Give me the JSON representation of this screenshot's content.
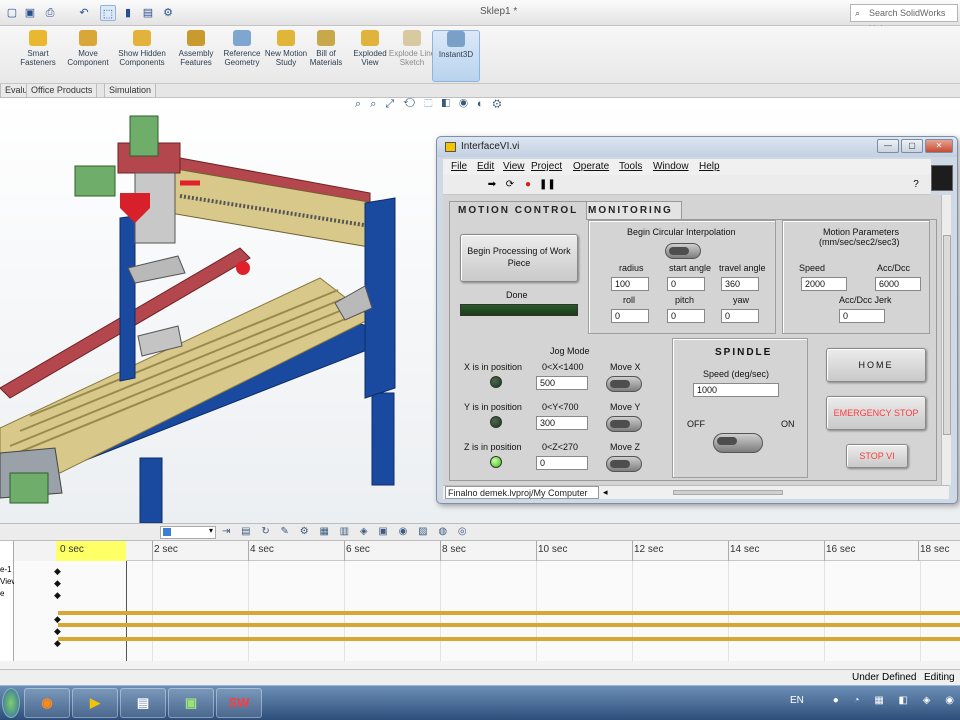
{
  "window": {
    "doc_title": "Sklep1 *",
    "search_placeholder": "Search SolidWorks Help"
  },
  "ribbon": {
    "buttons": [
      {
        "label": "Smart Fasteners"
      },
      {
        "label": "Move Component"
      },
      {
        "label": "Show Hidden Components"
      },
      {
        "label": "Assembly Features"
      },
      {
        "label": "Reference Geometry"
      },
      {
        "label": "New Motion Study"
      },
      {
        "label": "Bill of Materials"
      },
      {
        "label": "Exploded View"
      },
      {
        "label": "Explode Line Sketch"
      },
      {
        "label": "Instant3D"
      }
    ],
    "tabs": [
      "Evaluate",
      "Office Products",
      "Simulation"
    ]
  },
  "labview": {
    "title": "InterfaceVI.vi",
    "menu": [
      "File",
      "Edit",
      "View",
      "Project",
      "Operate",
      "Tools",
      "Window",
      "Help"
    ],
    "tabs": [
      "MOTION CONTROL",
      "MONITORING"
    ],
    "begin_button": "Begin Processing of Work Piece",
    "done_label": "Done",
    "circular": {
      "title": "Begin Circular Interpolation",
      "radius_label": "radius",
      "radius": "100",
      "start_label": "start angle",
      "start": "0",
      "travel_label": "travel angle",
      "travel": "360",
      "roll_label": "roll",
      "roll": "0",
      "pitch_label": "pitch",
      "pitch": "0",
      "yaw_label": "yaw",
      "yaw": "0"
    },
    "motion": {
      "title": "Motion Parameters",
      "units": "(mm/sec/sec2/sec3)",
      "speed_label": "Speed",
      "speed": "2000",
      "acc_label": "Acc/Dcc",
      "acc": "6000",
      "jerk_label": "Acc/Dcc Jerk",
      "jerk": "0"
    },
    "jog": {
      "title": "Jog Mode",
      "x_label": "X is in position",
      "x_range": "0<X<1400",
      "x_value": "500",
      "x_move": "Move X",
      "y_label": "Y is in position",
      "y_range": "0<Y<700",
      "y_value": "300",
      "y_move": "Move Y",
      "z_label": "Z is in position",
      "z_range": "0<Z<270",
      "z_value": "0",
      "z_move": "Move Z"
    },
    "spindle": {
      "title": "SPINDLE",
      "speed_label": "Speed   (deg/sec)",
      "speed": "1000",
      "off_label": "OFF",
      "on_label": "ON"
    },
    "home_button": "HOME",
    "emergency_button": "EMERGENCY STOP",
    "stopvi_button": "STOP VI",
    "status_path": "Finalno demek.lvproj/My Computer"
  },
  "timeline": {
    "ticks": [
      "0 sec",
      "2 sec",
      "4 sec",
      "6 sec",
      "8 sec",
      "10 sec",
      "12 sec",
      "14 sec",
      "16 sec",
      "18 sec"
    ],
    "tree_labels": [
      "e-1",
      "Viev",
      "e"
    ]
  },
  "status": {
    "state": "Under Defined",
    "editing": "Editing"
  },
  "taskbar": {
    "lang": "EN"
  },
  "colors": {
    "frame_blue": "#1a4aa0",
    "rail_red": "#b3474d",
    "table_wood": "#d8c98a",
    "gantry_green": "#6fae6a",
    "emergency_red": "#ff3b3b",
    "led_on": "#4fd12a",
    "led_off": "#2d4a2d",
    "timeline_gold": "#d7a734"
  }
}
